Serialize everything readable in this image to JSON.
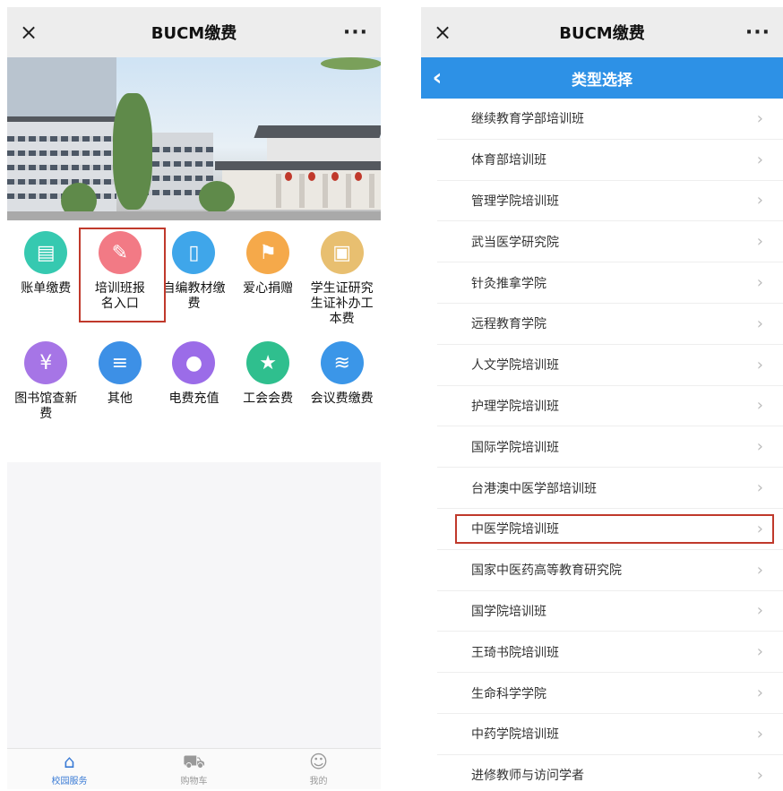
{
  "left_screen": {
    "topbar": {
      "close_glyph": "×",
      "title": "BUCM缴费",
      "more_glyph": "···"
    },
    "grid": [
      [
        {
          "label": "账单缴费",
          "icon": "bill-icon",
          "color": "#36c9b0",
          "glyph": "▤"
        },
        {
          "label": "培训班报名入口",
          "icon": "pencil-icon",
          "color": "#f27a85",
          "glyph": "✎"
        },
        {
          "label": "自编教材缴费",
          "icon": "book-icon",
          "color": "#3fa6ea",
          "glyph": "▯"
        },
        {
          "label": "爱心捐赠",
          "icon": "signpost-icon",
          "color": "#f5a94a",
          "glyph": "⚑"
        },
        {
          "label": "学生证研究生证补办工本费",
          "icon": "id-book-icon",
          "color": "#e8bf70",
          "glyph": "▣"
        }
      ],
      [
        {
          "label": "图书馆查新费",
          "icon": "yuan-coin-icon",
          "color": "#a675e6",
          "glyph": "¥"
        },
        {
          "label": "其他",
          "icon": "document-icon",
          "color": "#3d90e6",
          "glyph": "≡"
        },
        {
          "label": "电费充值",
          "icon": "bear-icon",
          "color": "#9b6ce8",
          "glyph": "●"
        },
        {
          "label": "工会会费",
          "icon": "star-icon",
          "color": "#2fbf8e",
          "glyph": "★"
        },
        {
          "label": "会议费缴费",
          "icon": "screen-cast-icon",
          "color": "#3b96e8",
          "glyph": "≋"
        }
      ]
    ],
    "tabbar": [
      {
        "label": "校园服务",
        "icon": "home-icon",
        "glyph": "⌂",
        "active": true
      },
      {
        "label": "购物车",
        "icon": "cart-icon",
        "glyph": "⛟",
        "active": false
      },
      {
        "label": "我的",
        "icon": "user-icon",
        "glyph": "☺",
        "active": false
      }
    ]
  },
  "right_screen": {
    "topbar": {
      "close_glyph": "×",
      "title": "BUCM缴费",
      "more_glyph": "···"
    },
    "header": {
      "back_glyph": "‹",
      "title": "类型选择"
    },
    "items": [
      "继续教育学部培训班",
      "体育部培训班",
      "管理学院培训班",
      "武当医学研究院",
      "针灸推拿学院",
      "远程教育学院",
      "人文学院培训班",
      "护理学院培训班",
      "国际学院培训班",
      "台港澳中医学部培训班",
      "中医学院培训班",
      "国家中医药高等教育研究院",
      "国学院培训班",
      "王琦书院培训班",
      "生命科学学院",
      "中药学院培训班",
      "进修教师与访问学者"
    ],
    "chevron_glyph": "›"
  }
}
